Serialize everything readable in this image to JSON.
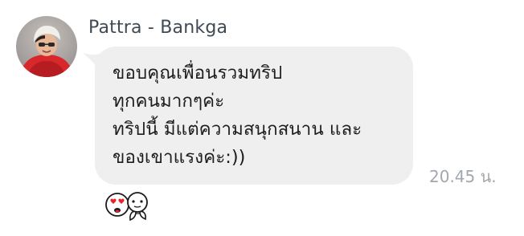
{
  "sender": {
    "name": "Pattra - Bankga"
  },
  "message": {
    "lines": [
      "ขอบคุณเพื่อนรวมทริป",
      "ทุกคนมากๆค่ะ",
      "ทริปนี้ มีแต่ความสนุกสนาน และ",
      "ของเขาแรงค่ะ:))"
    ],
    "timestamp": "20.45 น."
  },
  "reaction": {
    "icon": "love-eyes-sticker-icon"
  },
  "colors": {
    "bubble": "#efefef",
    "name_text": "#3f4a55",
    "timestamp_text": "#a2a8ae",
    "background": "#ffffff"
  }
}
